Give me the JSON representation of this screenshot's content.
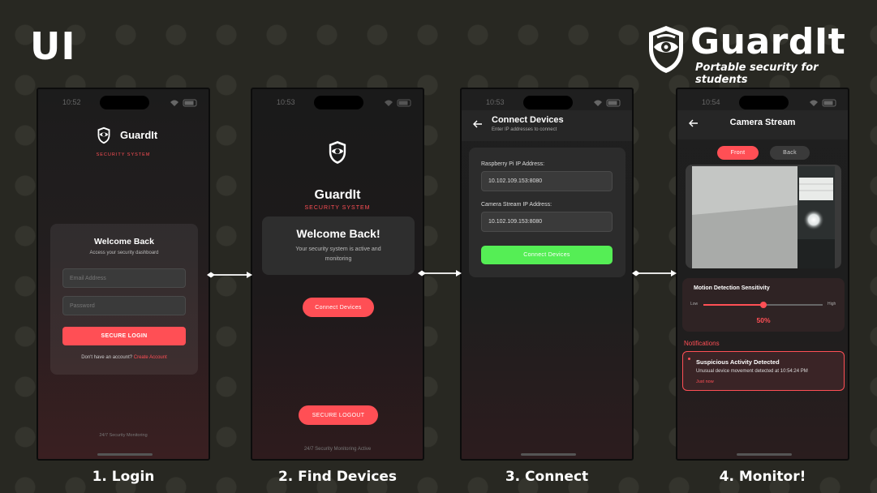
{
  "header": {
    "ui_title": "UI",
    "brand_name": "GuardIt",
    "brand_tagline": "Portable security for students"
  },
  "colors": {
    "accent": "#ff4f55",
    "success": "#55ee55",
    "background": "#282822"
  },
  "steps": [
    "1. Login",
    "2. Find Devices",
    "3. Connect",
    "4. Monitor!"
  ],
  "login": {
    "time": "10:52",
    "app_name": "GuardIt",
    "subtitle": "SECURITY SYSTEM",
    "card_title": "Welcome Back",
    "card_subtitle": "Access your security dashboard",
    "email_placeholder": "Email Address",
    "password_placeholder": "Password",
    "login_button": "SECURE LOGIN",
    "signup_prompt": "Don't have an account?",
    "signup_link": "Create Account",
    "footer": "24/7 Security Monitoring"
  },
  "find": {
    "time": "10:53",
    "app_name": "GuardIt",
    "subtitle": "SECURITY SYSTEM",
    "welcome_title": "Welcome Back!",
    "welcome_text_1": "Your security system is active and",
    "welcome_text_2": "monitoring",
    "connect_button": "Connect Devices",
    "logout_button": "SECURE LOGOUT",
    "footer": "24/7 Security Monitoring Active"
  },
  "connect": {
    "time": "10:53",
    "title": "Connect Devices",
    "subtitle": "Enter IP addresses to connect",
    "pi_label": "Raspberry Pi IP Address:",
    "pi_value": "10.102.109.153:8080",
    "cam_label": "Camera Stream IP Address:",
    "cam_value": "10.102.109.153:8080",
    "connect_button": "Connect Devices"
  },
  "monitor": {
    "time": "10:54",
    "title": "Camera Stream",
    "tab_front": "Front",
    "tab_back": "Back",
    "sensitivity_title": "Motion Detection Sensitivity",
    "low_label": "Low",
    "high_label": "High",
    "sensitivity_value": "50%",
    "sensitivity_fraction": 0.5,
    "notifications_title": "Notifications",
    "notif_title": "Suspicious Activity Detected",
    "notif_text": "Unusual device movement detected at 10:54:24 PM",
    "notif_time": "Just now"
  }
}
